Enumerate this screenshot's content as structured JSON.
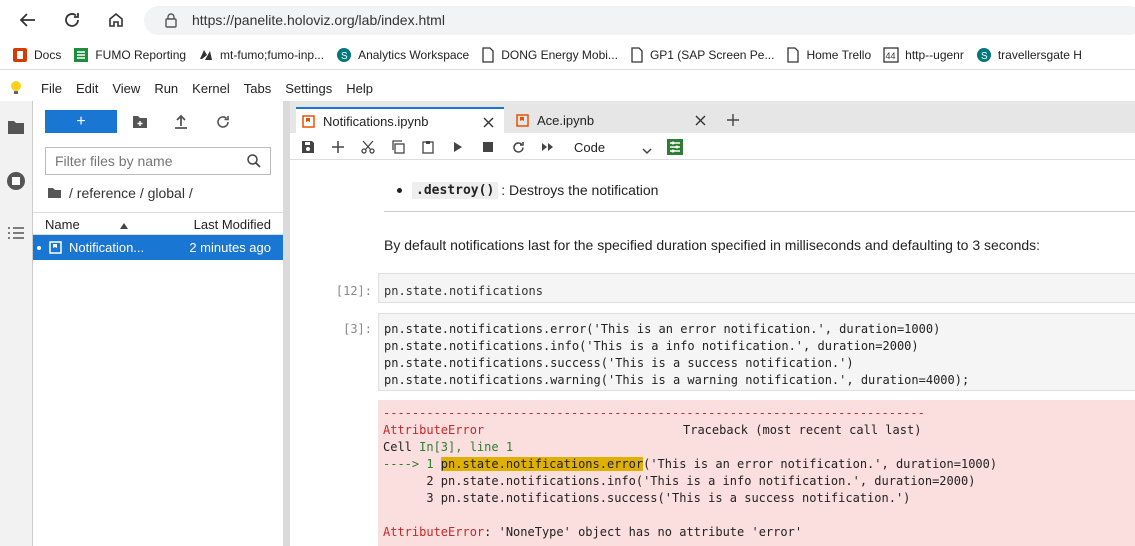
{
  "browser": {
    "url": "https://panelite.holoviz.org/lab/index.html"
  },
  "bookmarks": [
    {
      "label": "Docs",
      "icon": "office-icon"
    },
    {
      "label": "FUMO Reporting",
      "icon": "sheet-icon"
    },
    {
      "label": "mt-fumo;fumo-inp...",
      "icon": "azure-icon"
    },
    {
      "label": "Analytics Workspace",
      "icon": "sharepoint-icon"
    },
    {
      "label": "DONG Energy Mobi...",
      "icon": "page-icon"
    },
    {
      "label": "GP1 (SAP Screen Pe...",
      "icon": "page-icon"
    },
    {
      "label": "Home  Trello",
      "icon": "page-icon"
    },
    {
      "label": "http--ugenr",
      "icon": "44-icon"
    },
    {
      "label": "travellersgate  H",
      "icon": "sharepoint-icon"
    }
  ],
  "menu": [
    "File",
    "Edit",
    "View",
    "Run",
    "Kernel",
    "Tabs",
    "Settings",
    "Help"
  ],
  "filebrowser": {
    "new_label": "+",
    "filter_placeholder": "Filter files by name",
    "breadcrumb": "/ reference / global /",
    "col_name": "Name",
    "col_modified": "Last Modified",
    "files": [
      {
        "name": "Notification...",
        "modified": "2 minutes ago"
      }
    ]
  },
  "tabs": [
    {
      "label": "Notifications.ipynb",
      "active": true
    },
    {
      "label": "Ace.ipynb",
      "active": false
    }
  ],
  "toolbar": {
    "cell_type": "Code"
  },
  "notebook": {
    "bullet_code": ".destroy()",
    "bullet_text": ": Destroys the notification",
    "paragraph": "By default notifications last for the specified duration specified in milliseconds and defaulting to 3 seconds:",
    "cell1": {
      "prompt": "[12]:",
      "code": "pn.state.notifications"
    },
    "cell2": {
      "prompt": "[3]:",
      "lines": [
        "pn.state.notifications.error('This is an error notification.', duration=1000)",
        "pn.state.notifications.info('This is a info notification.', duration=2000)",
        "pn.state.notifications.success('This is a success notification.')",
        "pn.state.notifications.warning('This is a warning notification.', duration=4000);"
      ]
    },
    "error": {
      "dashes": "---------------------------------------------------------------------------",
      "name": "AttributeError",
      "traceback_label": "Traceback (most recent call last)",
      "cell_label": "Cell ",
      "cell_in": "In[3], line 1",
      "arrow": "----> 1 ",
      "hl": "pn.state.notifications.error",
      "l1_rest": "('This is an error notification.', duration=1000)",
      "l2": "      2 pn.state.notifications.info('This is a info notification.', duration=2000)",
      "l3": "      3 pn.state.notifications.success('This is a success notification.')",
      "final_name": "AttributeError",
      "final_msg": ": 'NoneType' object has no attribute 'error'"
    }
  },
  "colors": {
    "accent": "#1976d2",
    "error_bg": "#fbdede"
  }
}
